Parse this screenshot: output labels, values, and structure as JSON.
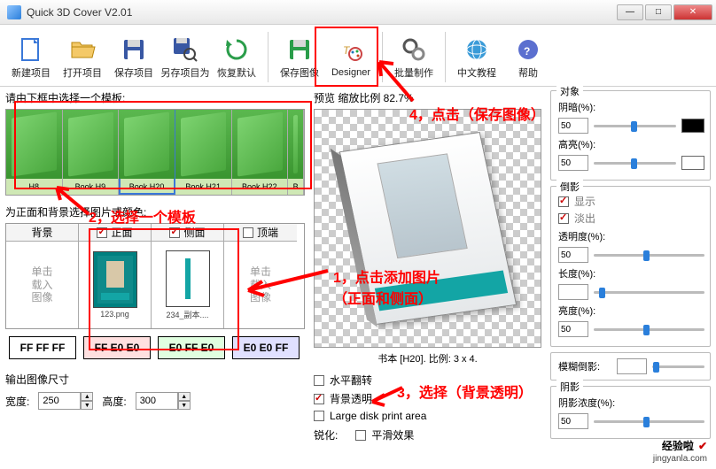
{
  "window": {
    "title": "Quick 3D Cover V2.01"
  },
  "toolbar": {
    "new": "新建项目",
    "open": "打开项目",
    "save": "保存项目",
    "saveas": "另存项目为",
    "reset": "恢复默认",
    "export": "保存图像",
    "designer": "Designer",
    "batch": "批量制作",
    "tutorial": "中文教程",
    "help": "帮助"
  },
  "left": {
    "tmpl_label": "请由下框中选择一个模板:",
    "tmpls": [
      "H8",
      "Book  H9",
      "Book  H20",
      "Book  H21",
      "Book  H22",
      "B"
    ],
    "src_label": "为正面和背景选择图片或颜色:",
    "cols": {
      "bg": {
        "head": "背景",
        "placeholder": "单击\n载入\n图像"
      },
      "front": {
        "head": "正面",
        "file": "123.png"
      },
      "side": {
        "head": "侧面",
        "file": "234_副本...."
      },
      "top": {
        "head": "顶端",
        "placeholder": "单击\n载入\n图像"
      }
    },
    "swatches": [
      {
        "label": "FF FF FF",
        "bg": "#ffffff"
      },
      {
        "label": "FF E0 E0",
        "bg": "#ffe0e0"
      },
      {
        "label": "E0 FF E0",
        "bg": "#e0ffe0"
      },
      {
        "label": "E0 E0 FF",
        "bg": "#e0e0ff"
      }
    ],
    "out_label": "输出图像尺寸",
    "w_label": "宽度:",
    "w_val": "250",
    "h_label": "高度:",
    "h_val": "300"
  },
  "mid": {
    "prev_label": "预览    缩放比例 82.7%",
    "book_info": "书本 [H20]. 比例: 3 x 4.",
    "opts": {
      "flip": "水平翻转",
      "transparent": "背景透明",
      "large": "Large disk print area"
    },
    "sharpen": "锐化:",
    "flat": "平滑效果"
  },
  "right": {
    "g1": {
      "title": "对象",
      "dark": "阴暗(%):",
      "dark_v": "50",
      "bright": "高亮(%):",
      "bright_v": "50"
    },
    "g2": {
      "title": "倒影",
      "show": "显示",
      "fade": "淡出",
      "opacity": "透明度(%):",
      "opacity_v": "50",
      "length": "长度(%):",
      "length_v": "",
      "brightness": "亮度(%):",
      "brightness_v": "50"
    },
    "g3": {
      "title": "模糊倒影:",
      "v": ""
    },
    "g4": {
      "title": "阴影",
      "opacity": "阴影浓度(%):",
      "opacity_v": "50"
    }
  },
  "annot": {
    "t1": "1，点击添加图片",
    "t1b": "（正面和侧面）",
    "t2": "2，选择一个模板",
    "t3": "3，选择（背景透明）",
    "t4": "4，点击（保存图像）"
  },
  "watermark": {
    "brand": "经验啦",
    "url": "jingyanla.com"
  }
}
